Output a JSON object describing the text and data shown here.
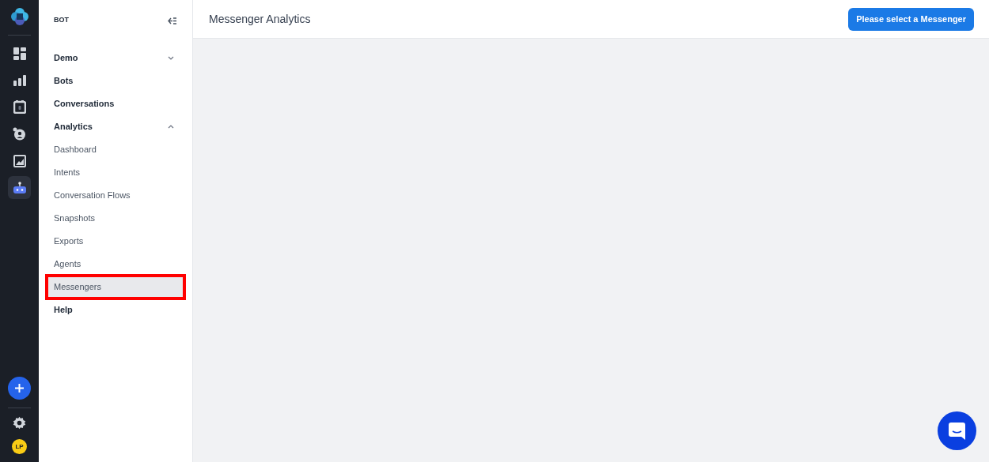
{
  "rail": {
    "items": [
      {
        "kind": "dashboard",
        "selected": false
      },
      {
        "kind": "chart",
        "selected": false
      },
      {
        "kind": "calendar",
        "selected": false
      },
      {
        "kind": "support",
        "selected": false
      },
      {
        "kind": "image",
        "selected": false
      },
      {
        "kind": "bot",
        "selected": true
      }
    ],
    "avatar": "LP"
  },
  "sidebar": {
    "title": "BOT",
    "items": [
      {
        "label": "Demo",
        "expanded": false
      },
      {
        "label": "Bots"
      },
      {
        "label": "Conversations"
      },
      {
        "label": "Analytics",
        "expanded": true,
        "children": [
          {
            "label": "Dashboard",
            "selected": false
          },
          {
            "label": "Intents",
            "selected": false
          },
          {
            "label": "Conversation Flows",
            "selected": false
          },
          {
            "label": "Snapshots",
            "selected": false
          },
          {
            "label": "Exports",
            "selected": false
          },
          {
            "label": "Agents",
            "selected": false
          },
          {
            "label": "Messengers",
            "selected": true
          }
        ]
      },
      {
        "label": "Help"
      }
    ]
  },
  "header": {
    "title": "Messenger Analytics",
    "button": "Please select a Messenger"
  }
}
